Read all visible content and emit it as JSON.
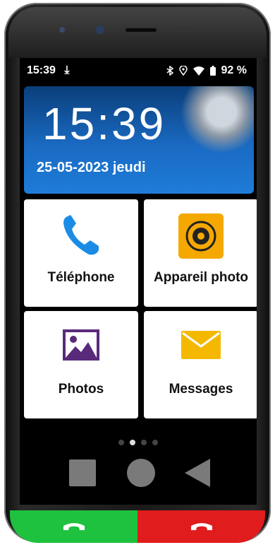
{
  "status_bar": {
    "time": "15:39",
    "battery": "92 %"
  },
  "clock_widget": {
    "time": "15:39",
    "date": "25-05-2023 jeudi"
  },
  "tiles": [
    {
      "label": "Téléphone",
      "icon": "phone-icon",
      "color": "#1a8ce6"
    },
    {
      "label": "Appareil photo",
      "icon": "camera-icon",
      "color": "#f5a800"
    },
    {
      "label": "Photos",
      "icon": "gallery-icon",
      "color": "#5a2a7a"
    },
    {
      "label": "Messages",
      "icon": "envelope-icon",
      "color": "#f5b800"
    }
  ],
  "page_indicator": {
    "count": 4,
    "active": 2
  },
  "nav": [
    "recents-button",
    "home-button",
    "back-button"
  ],
  "colors": {
    "answer": "#1ec23e",
    "hangup": "#e01c1c",
    "widget_bg": "#1a6ac2"
  }
}
